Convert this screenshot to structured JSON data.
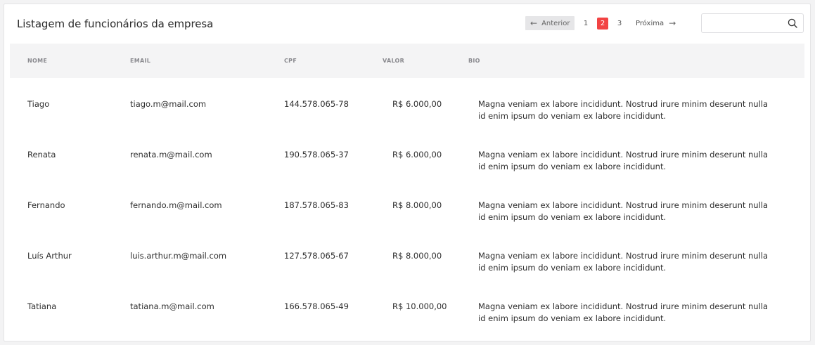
{
  "header": {
    "title": "Listagem de funcionários da empresa"
  },
  "pagination": {
    "prev_label": "Anterior",
    "pages": [
      "1",
      "2",
      "3"
    ],
    "active_page": "2",
    "next_label": "Próxima"
  },
  "search": {
    "value": "",
    "placeholder": ""
  },
  "table": {
    "columns": [
      "NOME",
      "EMAIL",
      "CPF",
      "VALOR",
      "BIO"
    ],
    "rows": [
      {
        "nome": "Tiago",
        "email": "tiago.m@mail.com",
        "cpf": "144.578.065-78",
        "valor": "R$ 6.000,00",
        "bio": "Magna veniam ex labore incididunt. Nostrud irure minim deserunt nulla id enim ipsum do veniam ex labore incididunt."
      },
      {
        "nome": "Renata",
        "email": "renata.m@mail.com",
        "cpf": "190.578.065-37",
        "valor": "R$ 6.000,00",
        "bio": "Magna veniam ex labore incididunt. Nostrud irure minim deserunt nulla id enim ipsum do veniam ex labore incididunt."
      },
      {
        "nome": "Fernando",
        "email": "fernando.m@mail.com",
        "cpf": "187.578.065-83",
        "valor": "R$ 8.000,00",
        "bio": "Magna veniam ex labore incididunt. Nostrud irure minim deserunt nulla id enim ipsum do veniam ex labore incididunt."
      },
      {
        "nome": "Luís Arthur",
        "email": "luis.arthur.m@mail.com",
        "cpf": "127.578.065-67",
        "valor": "R$ 8.000,00",
        "bio": "Magna veniam ex labore incididunt. Nostrud irure minim deserunt nulla id enim ipsum do veniam ex labore incididunt."
      },
      {
        "nome": "Tatiana",
        "email": "tatiana.m@mail.com",
        "cpf": "166.578.065-49",
        "valor": "R$ 10.000,00",
        "bio": "Magna veniam ex labore incididunt. Nostrud irure minim deserunt nulla id enim ipsum do veniam ex labore incididunt."
      }
    ]
  },
  "colors": {
    "accent": "#f24343",
    "header_bg": "#f4f4f5"
  },
  "icons": {
    "search": "search-icon",
    "prev": "arrow-left-icon",
    "next": "arrow-right-icon"
  }
}
